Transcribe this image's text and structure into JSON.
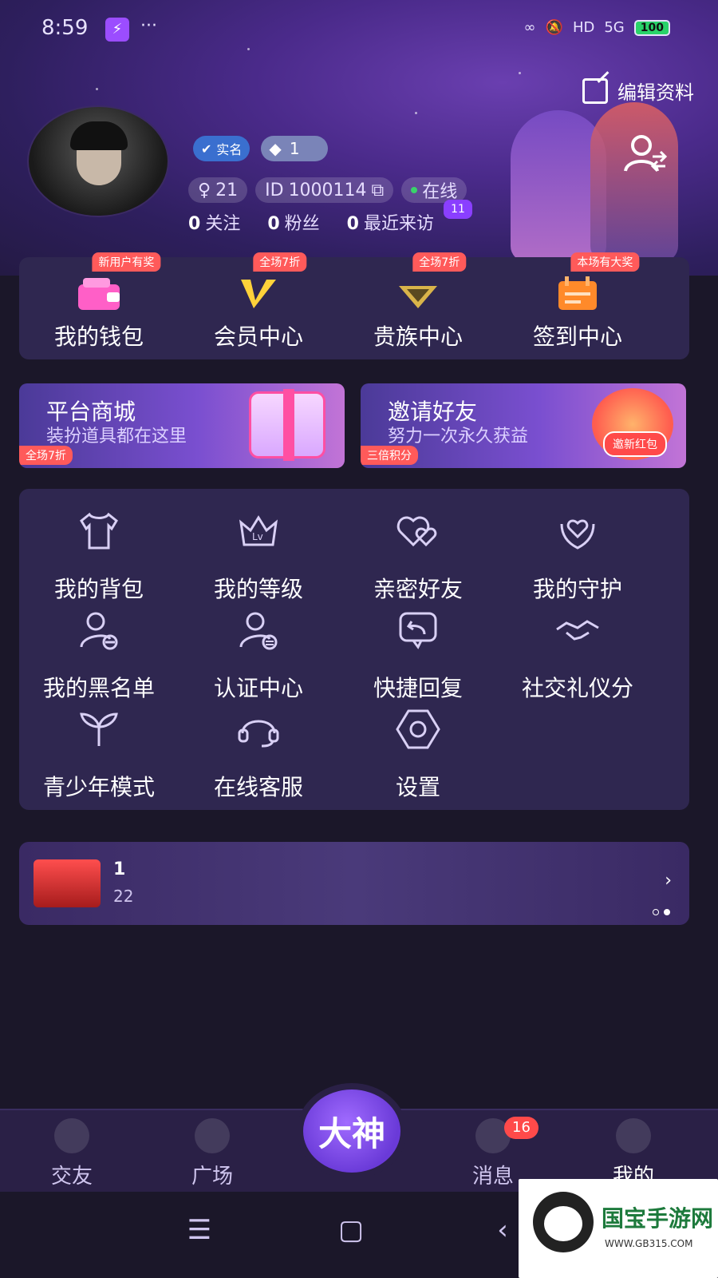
{
  "status_bar": {
    "time": "8:59",
    "dots": "···",
    "signal": "5G",
    "hd": "HD",
    "battery": "100"
  },
  "header": {
    "edit_profile_label": "编辑资料",
    "verified_label": "实名",
    "diamond_count": "1",
    "fans_level": "21",
    "user_id": "1000114",
    "online_label": "在线",
    "follow_count": "0",
    "follow_label": "关注",
    "fans_count": "0",
    "fans_label": "粉丝",
    "visitors_count": "0",
    "visitors_label": "最近来访",
    "visitors_badge": "11"
  },
  "quick_actions": [
    {
      "label": "我的钱包",
      "tag": "新用户有奖",
      "icon": "wallet-icon",
      "color": "#ff5fc7"
    },
    {
      "label": "会员中心",
      "tag": "全场7折",
      "icon": "vip-icon",
      "color": "#ffd23a"
    },
    {
      "label": "贵族中心",
      "tag": "全场7折",
      "icon": "noble-icon",
      "color": "#d9b44a"
    },
    {
      "label": "签到中心",
      "tag": "本场有大奖",
      "icon": "calendar-icon",
      "color": "#ff8a2a"
    }
  ],
  "promos": {
    "shop": {
      "title": "平台商城",
      "subtitle": "装扮道具都在这里",
      "tag": "全场7折"
    },
    "invite": {
      "title": "邀请好友",
      "subtitle": "努力一次永久获益",
      "tag": "三倍积分",
      "redpack_label": "邀新红包"
    }
  },
  "menu": [
    {
      "label": "我的背包",
      "icon": "tshirt-icon"
    },
    {
      "label": "我的等级",
      "icon": "level-crown-icon"
    },
    {
      "label": "亲密好友",
      "icon": "hearts-icon"
    },
    {
      "label": "我的守护",
      "icon": "guard-heart-icon"
    },
    {
      "label": "我的黑名单",
      "icon": "blocked-user-icon"
    },
    {
      "label": "认证中心",
      "icon": "verified-user-icon"
    },
    {
      "label": "快捷回复",
      "icon": "quick-reply-icon"
    },
    {
      "label": "社交礼仪分",
      "icon": "handshake-icon"
    },
    {
      "label": "青少年模式",
      "icon": "sprout-icon"
    },
    {
      "label": "在线客服",
      "icon": "headset-icon"
    },
    {
      "label": "设置",
      "icon": "settings-icon"
    }
  ],
  "banner": {
    "title": "1",
    "subtitle": "22"
  },
  "tabs": [
    {
      "label": "交友",
      "icon": "friends-icon"
    },
    {
      "label": "广场",
      "icon": "planet-icon"
    },
    {
      "label": "消息",
      "icon": "message-icon",
      "badge": "16"
    },
    {
      "label": "我的",
      "icon": "me-icon",
      "active": true
    }
  ],
  "center_tab_label": "大神",
  "watermark": {
    "text": "国宝手游网",
    "url": "WWW.GB315.COM"
  }
}
